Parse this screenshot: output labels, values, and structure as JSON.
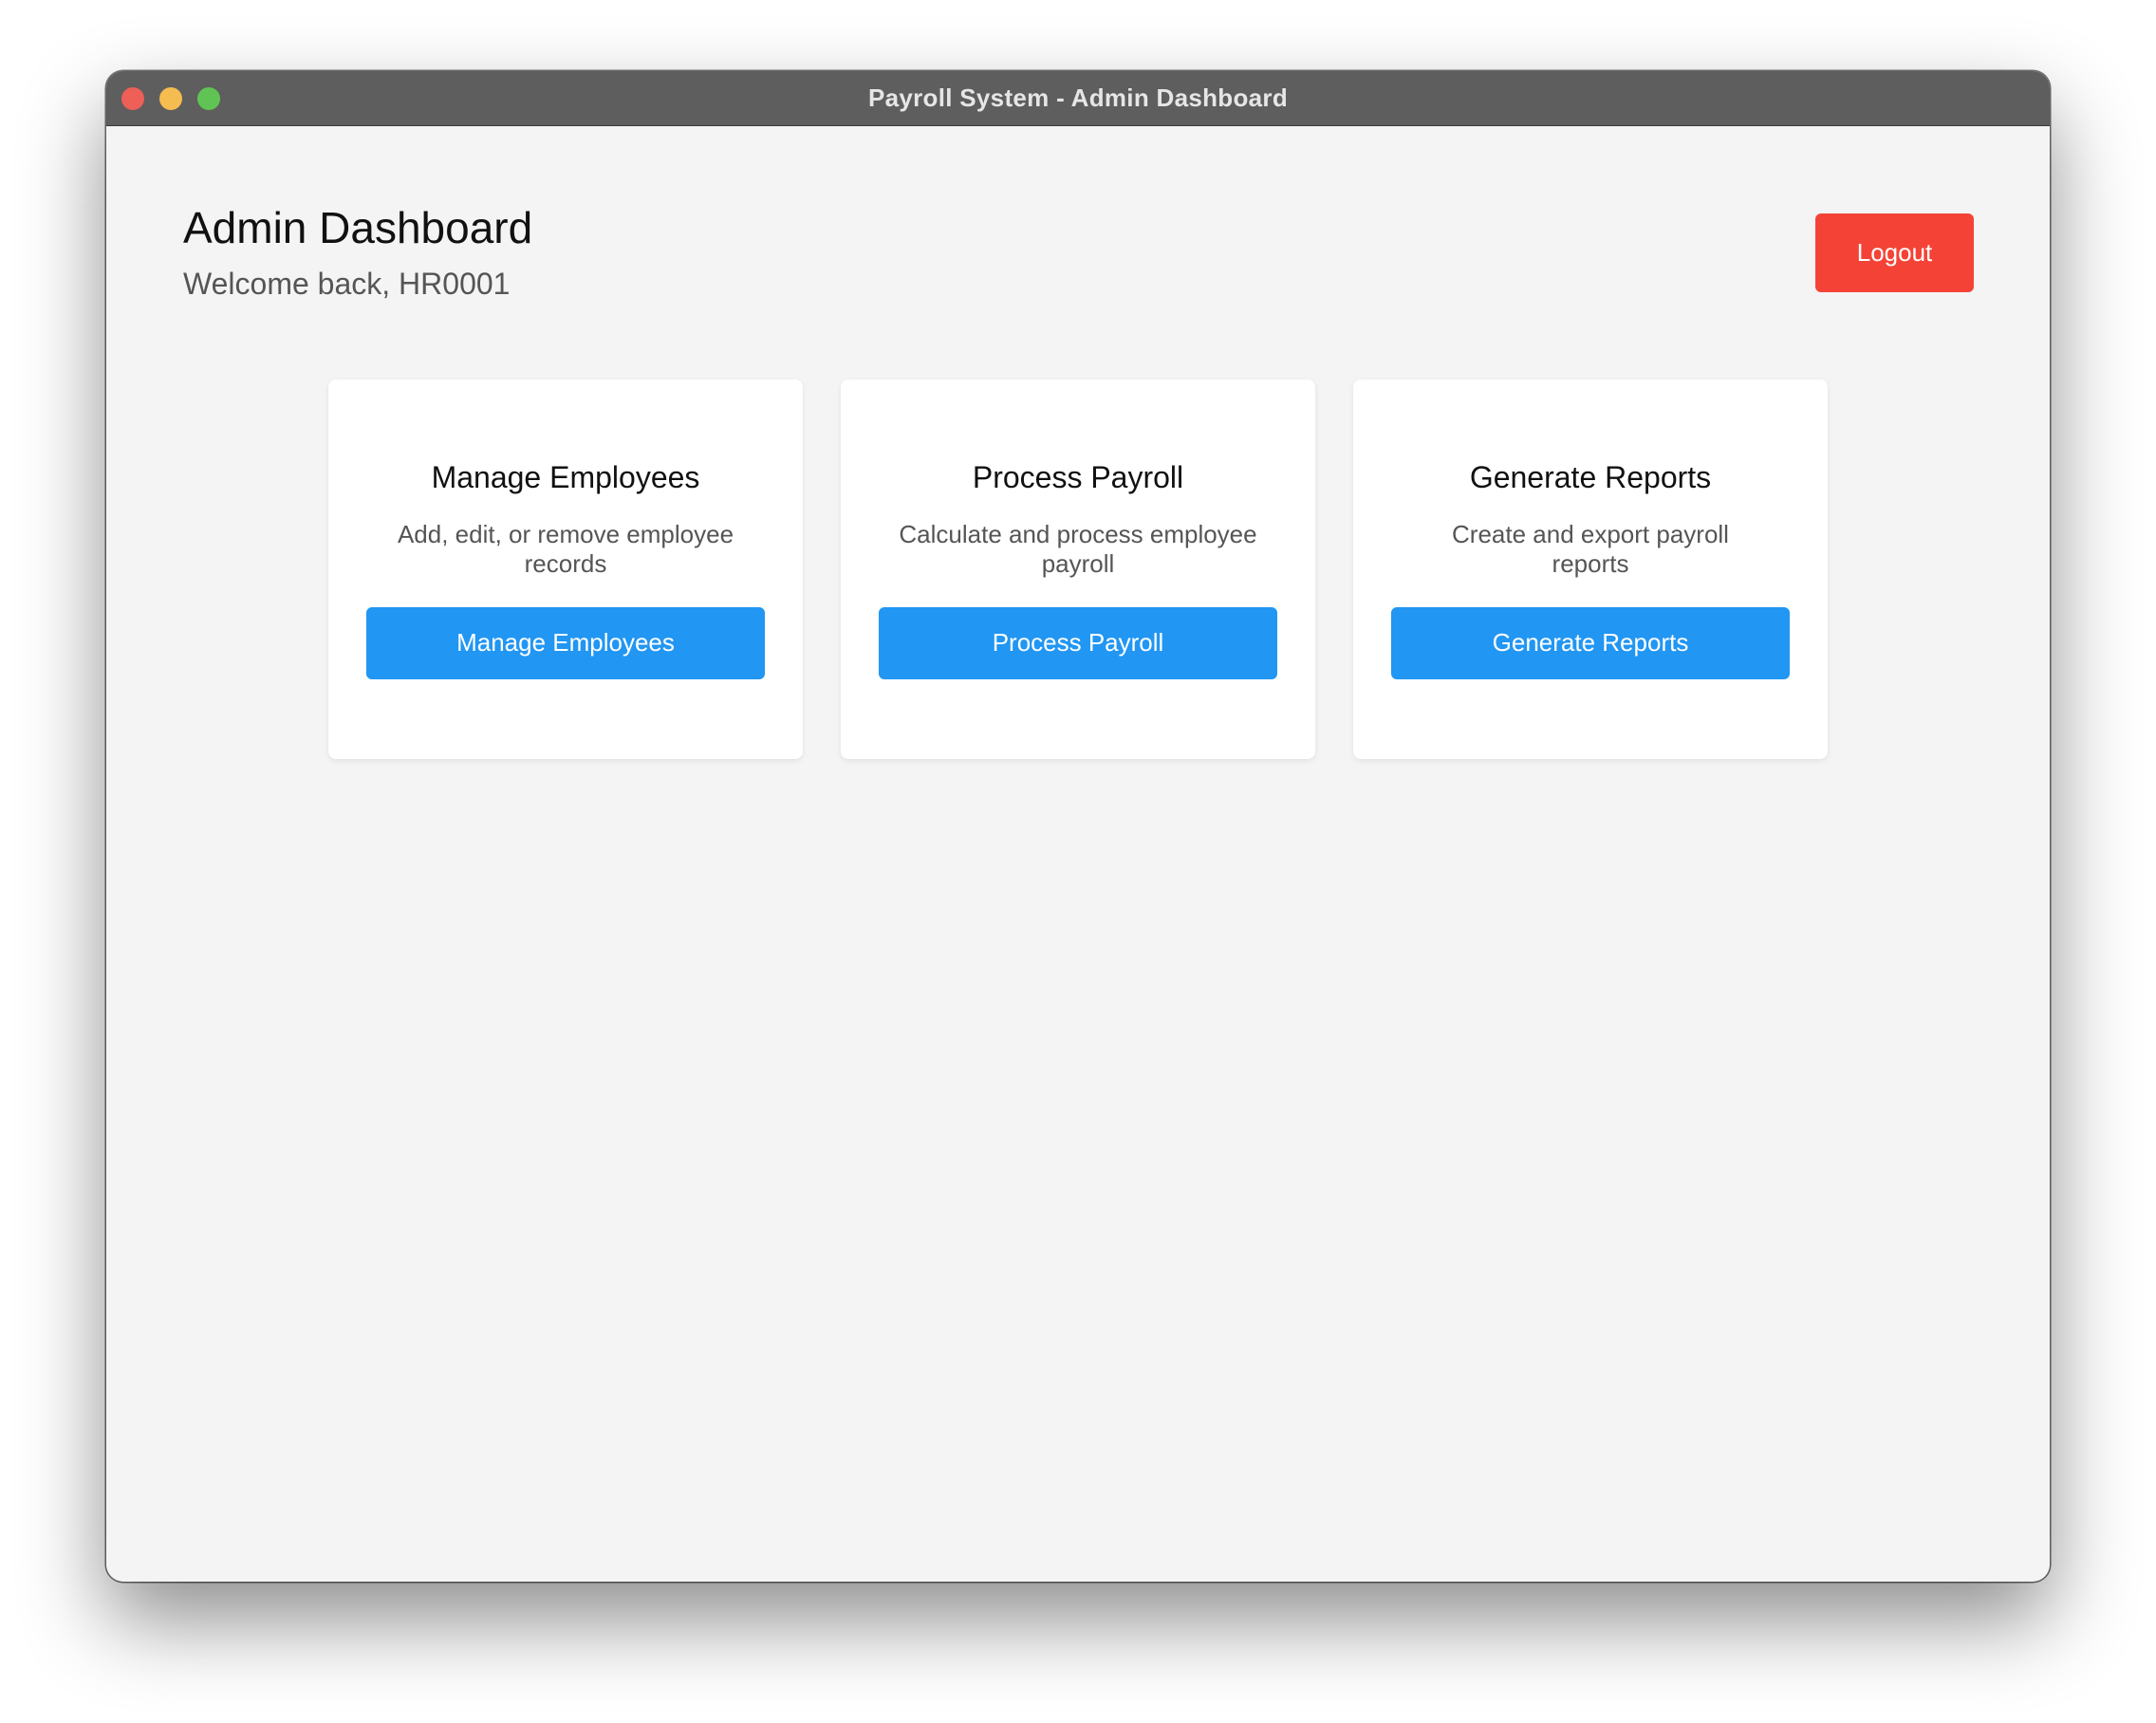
{
  "window": {
    "title": "Payroll System - Admin Dashboard"
  },
  "header": {
    "title": "Admin Dashboard",
    "welcome": "Welcome back, HR0001",
    "logout_label": "Logout"
  },
  "cards": [
    {
      "title": "Manage Employees",
      "description": "Add, edit, or remove employee records",
      "button_label": "Manage Employees"
    },
    {
      "title": "Process Payroll",
      "description": "Calculate and process employee payroll",
      "button_label": "Process Payroll"
    },
    {
      "title": "Generate Reports",
      "description": "Create and export payroll reports",
      "button_label": "Generate Reports"
    }
  ],
  "colors": {
    "logout": "#f44336",
    "primary_button": "#2196f3",
    "background": "#f4f4f4",
    "titlebar": "#5e5e5e"
  }
}
